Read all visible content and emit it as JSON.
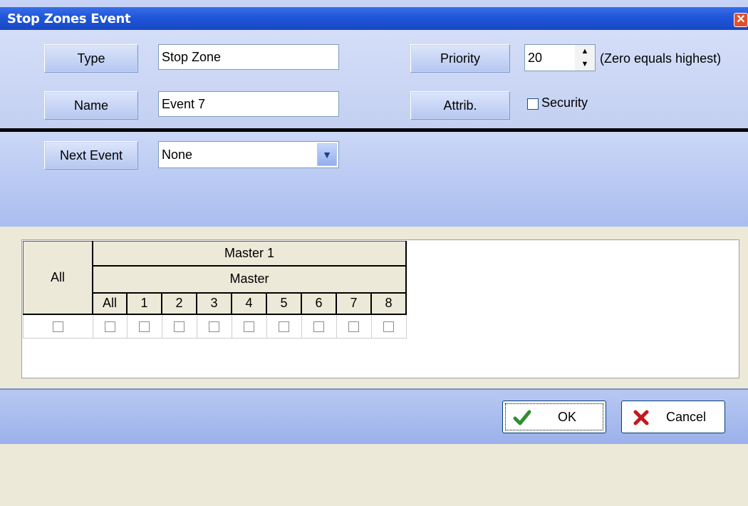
{
  "window": {
    "title": "Stop Zones Event",
    "close_glyph": "✕"
  },
  "fields": {
    "type_label": "Type",
    "type_value": "Stop Zone",
    "name_label": "Name",
    "name_value": "Event 7",
    "priority_label": "Priority",
    "priority_value": "20",
    "priority_note": "(Zero equals highest)",
    "attrib_label": "Attrib.",
    "security_label": "Security",
    "security_checked": false,
    "next_event_label": "Next Event",
    "next_event_value": "None"
  },
  "grid": {
    "all_header": "All",
    "group_header": "Master 1",
    "sub_header": "Master",
    "columns": [
      "All",
      "1",
      "2",
      "3",
      "4",
      "5",
      "6",
      "7",
      "8"
    ]
  },
  "buttons": {
    "ok": "OK",
    "cancel": "Cancel"
  },
  "colors": {
    "accent": "#1e56d8",
    "ok_check": "#2f8f2f",
    "cancel_x": "#c4181c"
  }
}
